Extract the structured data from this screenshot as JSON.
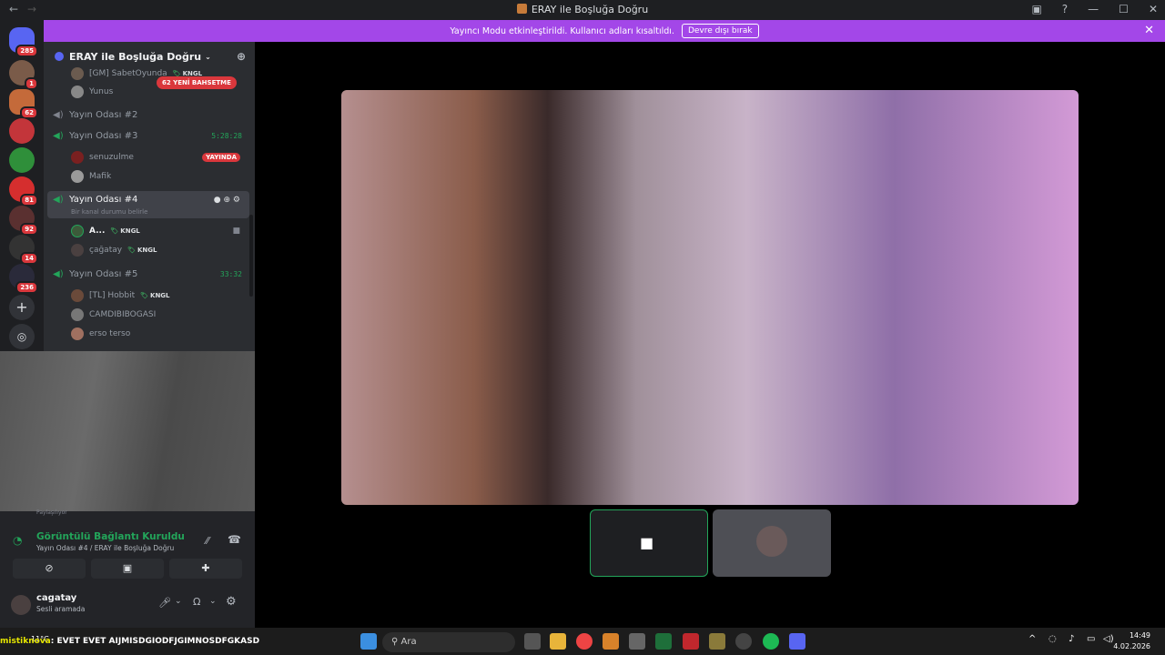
{
  "window": {
    "title": "ERAY ile Boşluğa Doğru",
    "back": "←",
    "forward": "→"
  },
  "rail": {
    "badges": [
      "285",
      "1",
      "62",
      "81",
      "92",
      "14",
      "236"
    ]
  },
  "banner": {
    "text": "Yayıncı Modu etkinleştirildi. Kullanıcı adları kısaltıldı.",
    "button": "Devre dışı bırak"
  },
  "guild": {
    "name": "ERAY ile Boşluğa Doğru"
  },
  "mention": "62 YENİ BAHSETME",
  "channels": [
    {
      "name": "Yayın Odası #2"
    },
    {
      "name": "Yayın Odası #3",
      "time": "5:28:28"
    },
    {
      "name": "Yayın Odası #4",
      "status": "Bir kanal durumu belirle"
    },
    {
      "name": "Yayın Odası #5",
      "time": "33:32"
    }
  ],
  "users": {
    "top1": "[GM] SabetOyunda",
    "top1_tag": "KNGL",
    "top2": "Yunus",
    "c3a": "senuzulme",
    "c3a_live": "YAYINDA",
    "c3b": "Mafik",
    "c4a": "A...",
    "c4a_tag": "KNGL",
    "c4b": "çağatay",
    "c4b_tag": "KNGL",
    "c5a": "[TL] Hobbit",
    "c5a_tag": "KNGL",
    "c5b": "CAMDIBIBOGASI",
    "c5c": "erso terso"
  },
  "voice": {
    "sharing": "Paylaşılıyor",
    "status": "Görüntülü Bağlantı Kuruldu",
    "channel": "Yayın Odası #4 / ERAY ile Boşluğa Doğru"
  },
  "me": {
    "name": "cagatay",
    "status": "Sesli aramada"
  },
  "taskbar": {
    "search": "Ara",
    "time": "14:49",
    "date": "4.02.2026",
    "weather": "11°C"
  },
  "chat": {
    "user": "mistiknova",
    "message": ": EVET EVET AIJMISDGIODFJGIMNOSDFGKASD"
  }
}
